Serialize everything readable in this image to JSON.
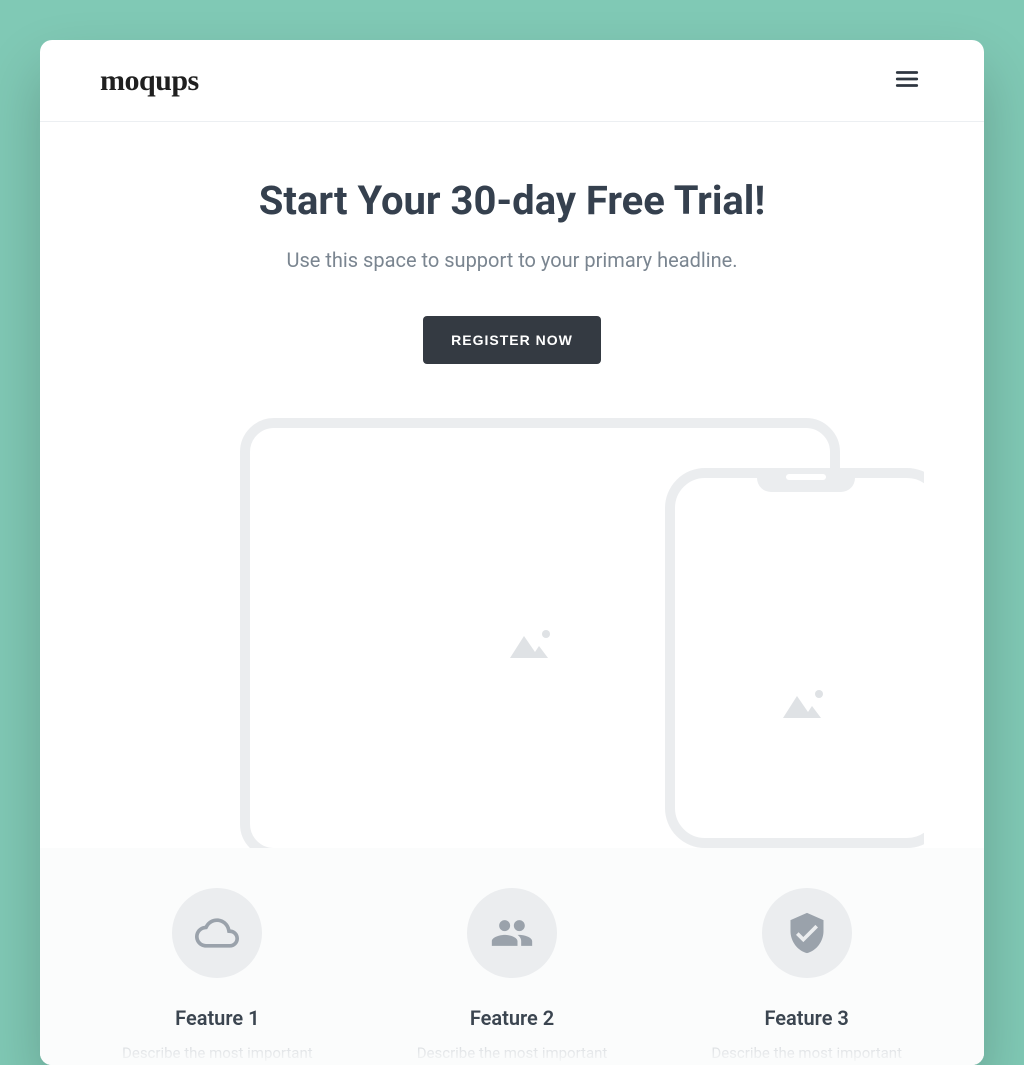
{
  "header": {
    "logo_text": "moqups"
  },
  "hero": {
    "headline": "Start Your 30-day Free Trial!",
    "subheading": "Use this space to support to your primary headline.",
    "cta_label": "REGISTER NOW"
  },
  "features": [
    {
      "icon": "cloud",
      "title": "Feature 1",
      "description": "Describe the most important"
    },
    {
      "icon": "people",
      "title": "Feature 2",
      "description": "Describe the most important"
    },
    {
      "icon": "shield-check",
      "title": "Feature 3",
      "description": "Describe the most important"
    }
  ]
}
